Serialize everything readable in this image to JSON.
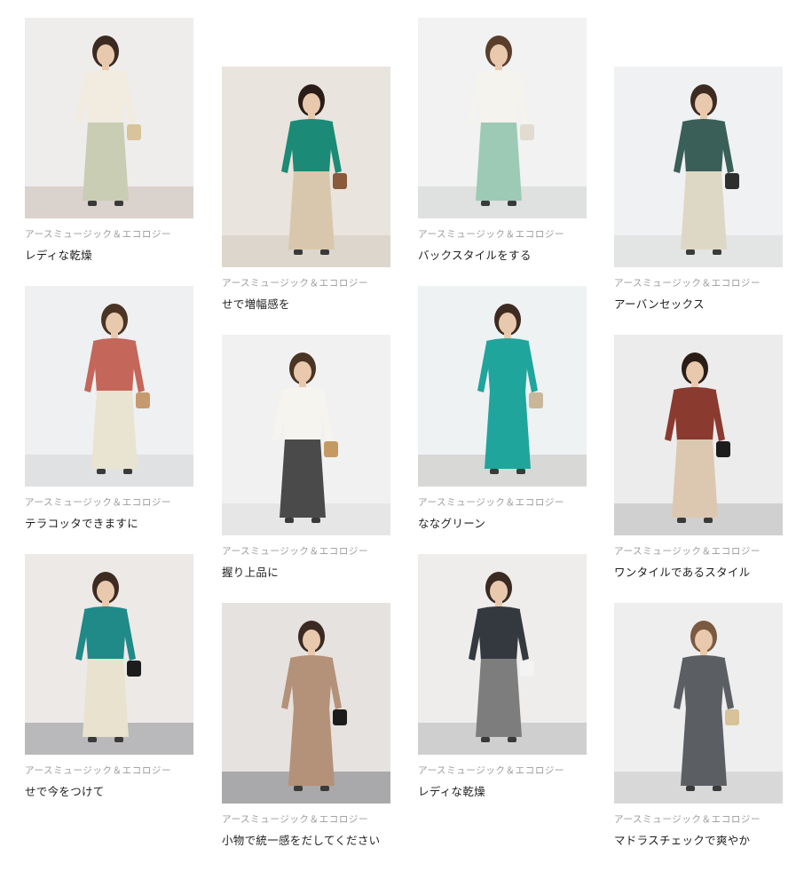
{
  "columns": [
    {
      "cards": [
        {
          "brand": "アースミュージック＆エコロジー",
          "title": "レディな乾燥",
          "image": "outfit-photo",
          "palette": {
            "bg": "#efecec",
            "floor": "#d9d2cd",
            "top": "#f1ecdf",
            "bottom": "#c8cdb4",
            "accent": "#d8c39a",
            "hair": "#3a2a22"
          }
        },
        {
          "brand": "アースミュージック＆エコロジー",
          "title": "テラコッタできますに",
          "image": "outfit-photo",
          "palette": {
            "bg": "#eef0f1",
            "floor": "#dfe1e2",
            "top": "#c4665a",
            "bottom": "#e9e3d2",
            "accent": "#c59a6e",
            "hair": "#4a3424"
          }
        },
        {
          "brand": "アースミュージック＆エコロジー",
          "title": "せで今をつけて",
          "image": "outfit-photo",
          "palette": {
            "bg": "#ece9e7",
            "floor": "#b9b9bb",
            "top": "#1f8a88",
            "bottom": "#e8e2cf",
            "accent": "#1c1c1c",
            "hair": "#3d2b22"
          }
        }
      ]
    },
    {
      "cards": [
        {
          "brand": "アースミュージック＆エコロジー",
          "title": "せで増幅感を",
          "image": "outfit-photo",
          "palette": {
            "bg": "#e9e4dd",
            "floor": "#ddd6cc",
            "top": "#1b8a76",
            "bottom": "#d9c7ad",
            "accent": "#8a5a3a",
            "hair": "#2a1d17"
          }
        },
        {
          "brand": "アースミュージック＆エコロジー",
          "title": "握り上品に",
          "image": "outfit-photo",
          "palette": {
            "bg": "#f1f1f1",
            "floor": "#e6e6e6",
            "top": "#f6f4ef",
            "bottom": "#4a4a4a",
            "accent": "#c59a62",
            "hair": "#4a3424"
          }
        },
        {
          "brand": "アースミュージック＆エコロジー",
          "title": "小物で統一感をだしてください",
          "image": "outfit-photo",
          "palette": {
            "bg": "#e6e2df",
            "floor": "#a9a9ab",
            "top": "#b49179",
            "bottom": "#b49179",
            "accent": "#1c1c1c",
            "hair": "#3a2a22"
          }
        }
      ]
    },
    {
      "cards": [
        {
          "brand": "アースミュージック＆エコロジー",
          "title": "バックスタイルをする",
          "image": "outfit-photo",
          "palette": {
            "bg": "#f2f2f2",
            "floor": "#dfe0e0",
            "top": "#f5f3ee",
            "bottom": "#9ccab5",
            "accent": "#e2dcd0",
            "hair": "#5a3e2c"
          }
        },
        {
          "brand": "アースミュージック＆エコロジー",
          "title": "ななグリーン",
          "image": "outfit-photo",
          "palette": {
            "bg": "#eef2f3",
            "floor": "#d8d8d6",
            "top": "#1fa59c",
            "bottom": "#1fa59c",
            "accent": "#c9b79a",
            "hair": "#3d2b22"
          }
        },
        {
          "brand": "アースミュージック＆エコロジー",
          "title": "レディな乾燥",
          "image": "outfit-photo",
          "palette": {
            "bg": "#efedeb",
            "floor": "#cfcfcf",
            "top": "#34393f",
            "bottom": "#7d7d7d",
            "accent": "#f3f3f3",
            "hair": "#3a2a22"
          }
        }
      ]
    },
    {
      "cards": [
        {
          "brand": "アースミュージック＆エコロジー",
          "title": "アーバンセックス",
          "image": "outfit-photo",
          "palette": {
            "bg": "#f0f1f2",
            "floor": "#e3e4e4",
            "top": "#3a5e58",
            "bottom": "#ddd8c6",
            "accent": "#2e2e2e",
            "hair": "#3d2b22"
          }
        },
        {
          "brand": "アースミュージック＆エコロジー",
          "title": "ワンタイルであるスタイル",
          "image": "outfit-photo",
          "palette": {
            "bg": "#ececec",
            "floor": "#d0d0d0",
            "top": "#8b3a30",
            "bottom": "#dcc8b0",
            "accent": "#1c1c1c",
            "hair": "#2a1d17"
          }
        },
        {
          "brand": "アースミュージック＆エコロジー",
          "title": "マドラスチェックで爽やか",
          "image": "outfit-photo",
          "palette": {
            "bg": "#eeeeee",
            "floor": "#d8d8d8",
            "top": "#5b5f63",
            "bottom": "#5b5f63",
            "accent": "#d8c29a",
            "hair": "#7a5a40"
          }
        }
      ]
    }
  ]
}
